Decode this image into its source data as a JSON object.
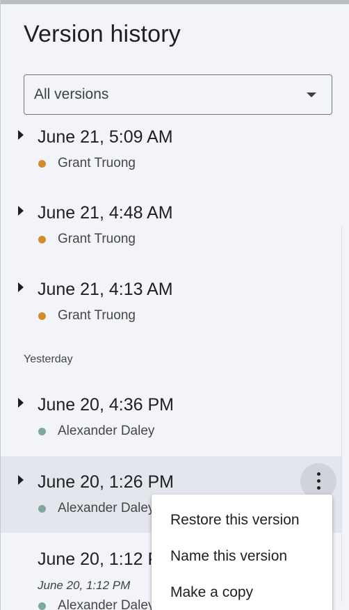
{
  "panel": {
    "title": "Version history",
    "filter": {
      "selected": "All versions"
    },
    "section_label_yesterday": "Yesterday"
  },
  "colors": {
    "author_grant": "#d38b2c",
    "author_alexander": "#7fa89c",
    "selected_row": "#e3e6ec",
    "panel_bg": "#f2f4f9"
  },
  "versions": [
    {
      "time": "June 21, 5:09 AM",
      "author": "Grant Truong"
    },
    {
      "time": "June 21, 4:48 AM",
      "author": "Grant Truong"
    },
    {
      "time": "June 21, 4:13 AM",
      "author": "Grant Truong"
    },
    {
      "time": "June 20, 4:36 PM",
      "author": "Alexander Daley"
    },
    {
      "time": "June 20, 1:26 PM",
      "author": "Alexander Daley"
    },
    {
      "time": "June 20, 1:12 PM",
      "subtitle": "June 20, 1:12 PM",
      "author": "Alexander Daley"
    }
  ],
  "context_menu": {
    "items": [
      {
        "label": "Restore this version"
      },
      {
        "label": "Name this version"
      },
      {
        "label": "Make a copy"
      }
    ]
  },
  "icons": {
    "filter_dropdown": "caret-down-icon",
    "expand": "triangle-right-icon",
    "more_actions": "more-vert-icon"
  }
}
